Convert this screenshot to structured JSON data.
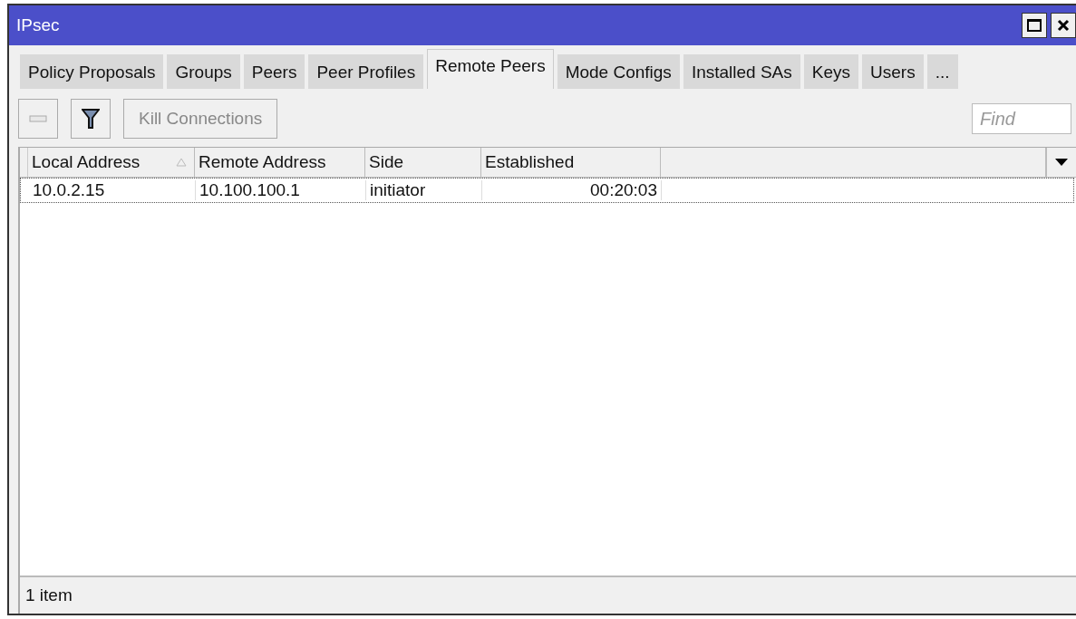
{
  "window": {
    "title": "IPsec"
  },
  "tabs": [
    {
      "label": "Policy Proposals",
      "selected": false
    },
    {
      "label": "Groups",
      "selected": false
    },
    {
      "label": "Peers",
      "selected": false
    },
    {
      "label": "Peer Profiles",
      "selected": false
    },
    {
      "label": "Remote Peers",
      "selected": true
    },
    {
      "label": "Mode Configs",
      "selected": false
    },
    {
      "label": "Installed SAs",
      "selected": false
    },
    {
      "label": "Keys",
      "selected": false
    },
    {
      "label": "Users",
      "selected": false
    },
    {
      "label": "...",
      "selected": false
    }
  ],
  "toolbar": [
    {
      "kind": "remove",
      "disabled": true
    },
    {
      "kind": "filter",
      "disabled": false
    },
    {
      "kind": "text",
      "label": "Kill Connections",
      "disabled": true
    }
  ],
  "search": {
    "placeholder": "Find"
  },
  "table": {
    "columns": [
      {
        "label": "Local Address",
        "sorted": true,
        "kind": "text"
      },
      {
        "label": "Remote Address",
        "sorted": false,
        "kind": "text"
      },
      {
        "label": "Side",
        "sorted": false,
        "kind": "text"
      },
      {
        "label": "Established",
        "sorted": false,
        "kind": "duration"
      }
    ],
    "rows": [
      {
        "focused": true,
        "cells": [
          "10.0.2.15",
          "10.100.100.1",
          "initiator",
          "00:20:03"
        ]
      }
    ]
  },
  "status_bar": {
    "text": "1 item"
  }
}
